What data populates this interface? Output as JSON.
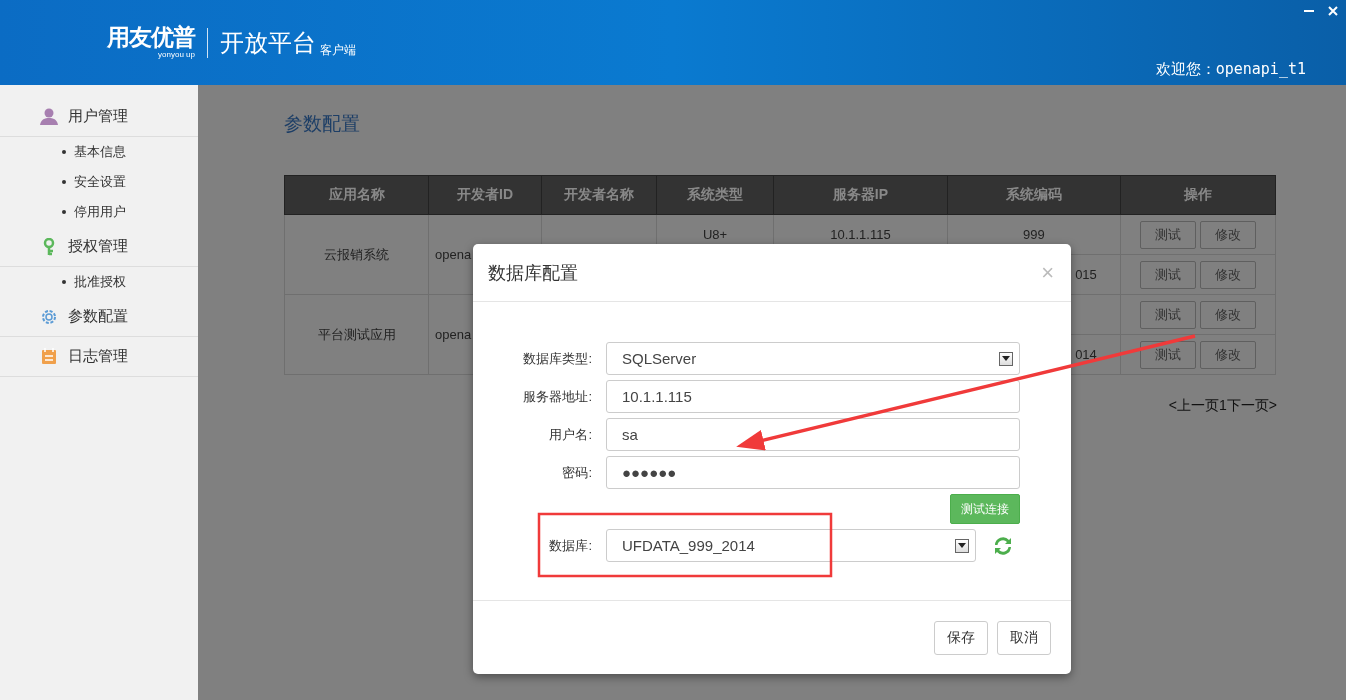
{
  "header": {
    "logo": "用友优普",
    "logo_sub": "yonyou up",
    "title": "开放平台",
    "subtitle": "客户端",
    "welcome": "欢迎您：openapi_t1"
  },
  "sidebar": {
    "items": [
      {
        "label": "用户管理",
        "children": [
          {
            "label": "基本信息"
          },
          {
            "label": "安全设置"
          },
          {
            "label": "停用用户"
          }
        ]
      },
      {
        "label": "授权管理",
        "children": [
          {
            "label": "批准授权"
          }
        ]
      },
      {
        "label": "参数配置"
      },
      {
        "label": "日志管理"
      }
    ]
  },
  "page_title": "参数配置",
  "table": {
    "columns": [
      "应用名称",
      "开发者ID",
      "开发者名称",
      "系统类型",
      "服务器IP",
      "系统编码",
      "操作"
    ],
    "rows": [
      {
        "app": "云报销系统",
        "dev_id": "opena",
        "subrows": [
          {
            "system": "U8+",
            "ip": "10.1.1.115",
            "code": "999",
            "actions": [
              "测试",
              "修改"
            ]
          },
          {
            "code": "015",
            "actions": [
              "测试",
              "修改"
            ]
          }
        ]
      },
      {
        "app": "平台测试应用",
        "dev_id": "opena",
        "subrows": [
          {
            "actions": [
              "测试",
              "修改"
            ]
          },
          {
            "code": "014",
            "actions": [
              "测试",
              "修改"
            ]
          }
        ]
      }
    ]
  },
  "pager": "<上一页1下一页>",
  "dialog": {
    "title": "数据库配置",
    "close": "×",
    "fields": [
      {
        "label": "数据库类型:",
        "kind": "select",
        "value": "SQLServer"
      },
      {
        "label": "服务器地址:",
        "kind": "text",
        "value": "10.1.1.115"
      },
      {
        "label": "用户名:",
        "kind": "text",
        "value": "sa"
      },
      {
        "label": "密码:",
        "kind": "text",
        "value": "●●●●●●"
      }
    ],
    "test_button": "测试连接",
    "database": {
      "label": "数据库:",
      "kind": "select",
      "value": "UFDATA_999_2014"
    },
    "buttons": [
      "保存",
      "取消"
    ]
  },
  "annotations": {
    "arrow": true,
    "highlight_box": true
  }
}
